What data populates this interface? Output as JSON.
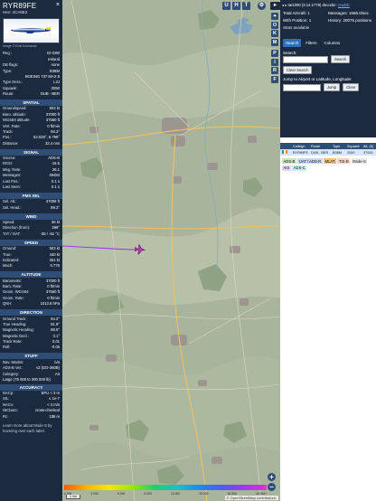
{
  "aircraft": {
    "callsign": "RYR89FE",
    "hex_line": "Hex: 4CA8E2",
    "close_glyph": "×",
    "image_credit": "Image © Emil Kucharski",
    "reg_rows": [
      {
        "k": "Reg.:",
        "v": "EI-GIW"
      },
      {
        "k": "",
        "v": "Ireland"
      },
      {
        "k": "DB flags:",
        "v": "none"
      },
      {
        "k": "Type:",
        "v": "B38M"
      },
      {
        "k": "",
        "v": "BOEING 737 MAX 8"
      },
      {
        "k": "Type Desc.:",
        "v": "L2J"
      },
      {
        "k": "Squawk:",
        "v": "2050"
      },
      {
        "k": "Route:",
        "v": "DUB - BER"
      }
    ],
    "spatial_title": "SPATIAL",
    "spatial_rows": [
      {
        "k": "Groundspeed:",
        "v": "503 kt"
      },
      {
        "k": "Baro. altitude:",
        "v": "37000 ft"
      },
      {
        "k": "WGS84 altitude:",
        "v": "37550 ft"
      },
      {
        "k": "Vert. Rate:",
        "v": "0 ft/min"
      },
      {
        "k": "Track:",
        "v": "94.3°"
      },
      {
        "k": "Pos.:",
        "v": "53.028°, 6.796°"
      },
      {
        "k": "Distance:",
        "v": "32.4 nmi"
      }
    ],
    "signal_title": "SIGNAL",
    "signal_rows": [
      {
        "k": "Source:",
        "v": "ADS-B"
      },
      {
        "k": "RSSI:",
        "v": "-15.5"
      },
      {
        "k": "Msg. Rate:",
        "v": "26.1"
      },
      {
        "k": "Messages:",
        "v": "49484"
      },
      {
        "k": "Last Pos.:",
        "v": "0.1 s"
      },
      {
        "k": "Last Seen:",
        "v": "0.1 s"
      }
    ],
    "fms_title": "FMS SEL",
    "fms_rows": [
      {
        "k": "Sel. Alt.:",
        "v": "37008 ft"
      },
      {
        "k": "Sel. Head.:",
        "v": "89.3°"
      }
    ],
    "wind_title": "WIND",
    "wind_rows": [
      {
        "k": "Speed:",
        "v": "36 kt"
      },
      {
        "k": "Direction (from):",
        "v": "298°"
      },
      {
        "k": "TAT / OAT:",
        "v": "-36 / -61 °C"
      }
    ],
    "speed_title": "SPEED",
    "speed_rows": [
      {
        "k": "Ground:",
        "v": "503 kt"
      },
      {
        "k": "True:",
        "v": "440 kt"
      },
      {
        "k": "Indicated:",
        "v": "251 kt"
      },
      {
        "k": "Mach:",
        "v": "0.776"
      }
    ],
    "altitude_title": "ALTITUDE",
    "altitude_rows": [
      {
        "k": "Barometric:",
        "v": "37000 ft"
      },
      {
        "k": "Baro. Rate:",
        "v": "0 ft/min"
      },
      {
        "k": "Geom. WGS84:",
        "v": "37550 ft"
      },
      {
        "k": "Geom. Rate:",
        "v": "0 ft/min"
      },
      {
        "k": "QNH:",
        "v": "1013.6 hPa"
      }
    ],
    "direction_title": "DIRECTION",
    "direction_rows": [
      {
        "k": "Ground Track:",
        "v": "94.3°"
      },
      {
        "k": "True Heading:",
        "v": "91.9°"
      },
      {
        "k": "Magnetic Heading:",
        "v": "88.8°"
      },
      {
        "k": "Magnetic Decl.:",
        "v": "3.1°"
      },
      {
        "k": "Track Rate:",
        "v": "0.01"
      },
      {
        "k": "Roll:",
        "v": "-0.05"
      }
    ],
    "stuff_title": "STUFF",
    "stuff_rows": [
      {
        "k": "Nav. Modes:",
        "v": "n/a"
      },
      {
        "k": "ADS-B Ver.:",
        "v": "v2 (DO-260B)"
      },
      {
        "k": "Category:",
        "v": "A3"
      }
    ],
    "category_desc": "Large (75 000 to 300 000 lb)",
    "accuracy_title": "ACCURACY",
    "accuracy_rows": [
      {
        "k": "NACp:",
        "v": "EPU < 3 m"
      },
      {
        "k": "SIL:",
        "v": "≤ 1e-7"
      },
      {
        "k": "NACv:",
        "v": "< 3 m/s"
      },
      {
        "k": "NICbaro:",
        "v": "cross-checked"
      },
      {
        "k": "Rc:",
        "v": "186 m"
      }
    ],
    "footer": "Learn more about Mode-S by hovering over each label."
  },
  "map": {
    "top_buttons": [
      "U",
      "H",
      "T"
    ],
    "side_buttons": [
      "O",
      "K",
      "M",
      "P",
      "I",
      "R",
      "F"
    ],
    "zoom_in": "+",
    "zoom_out": "−",
    "altitude_scale_labels": [
      "2 000",
      "4 000",
      "6 000",
      "8 000",
      "10 000",
      "20 000",
      "30 000",
      "40 000+"
    ],
    "scale_text": "1 nm",
    "attribution": "© OpenStreetMap contributors."
  },
  "right": {
    "version_prefix": "tar1090 (3.14.1779) decoder: ",
    "version_link": "readsb",
    "stats": [
      {
        "label": "Total Aircraft: 1"
      },
      {
        "label": "Messages: 1566.0/sec"
      },
      {
        "label": "With Position: 1"
      },
      {
        "label": "History: 20075 positions"
      },
      {
        "label": "Stats available"
      },
      {
        "label": ""
      }
    ],
    "tabs": [
      "Search",
      "Filters",
      "Columns"
    ],
    "search_label": "Search:",
    "search_button": "Search",
    "clear_search_button": "Clear Search",
    "jump_label": "Jump to Airport or Latitude, Longitude:",
    "jump_button": "Jump",
    "clear_button": "Clear",
    "table_headers": [
      "Callsign",
      "Route",
      "Type",
      "Squawk",
      "Alt. (ft)"
    ],
    "table_rows": [
      {
        "flag": "IE",
        "callsign": "RYR89FE",
        "route": "DUB - BER",
        "type": "B38M",
        "squawk": "2050",
        "alt": "37000"
      }
    ],
    "legend": [
      {
        "label": "ADS-B",
        "color": "#c9e6c0"
      },
      {
        "label": "UAT / ADS-R",
        "color": "#c5d6f7"
      },
      {
        "label": "MLAT",
        "color": "#f3c27a"
      },
      {
        "label": "TIS-B",
        "color": "#ffd1c2"
      },
      {
        "label": "Mode-S",
        "color": "#e9e9e9"
      },
      {
        "label": "AIS",
        "color": "#e5d5f5"
      },
      {
        "label": "ADS-C",
        "color": "#c6eef2"
      }
    ]
  }
}
